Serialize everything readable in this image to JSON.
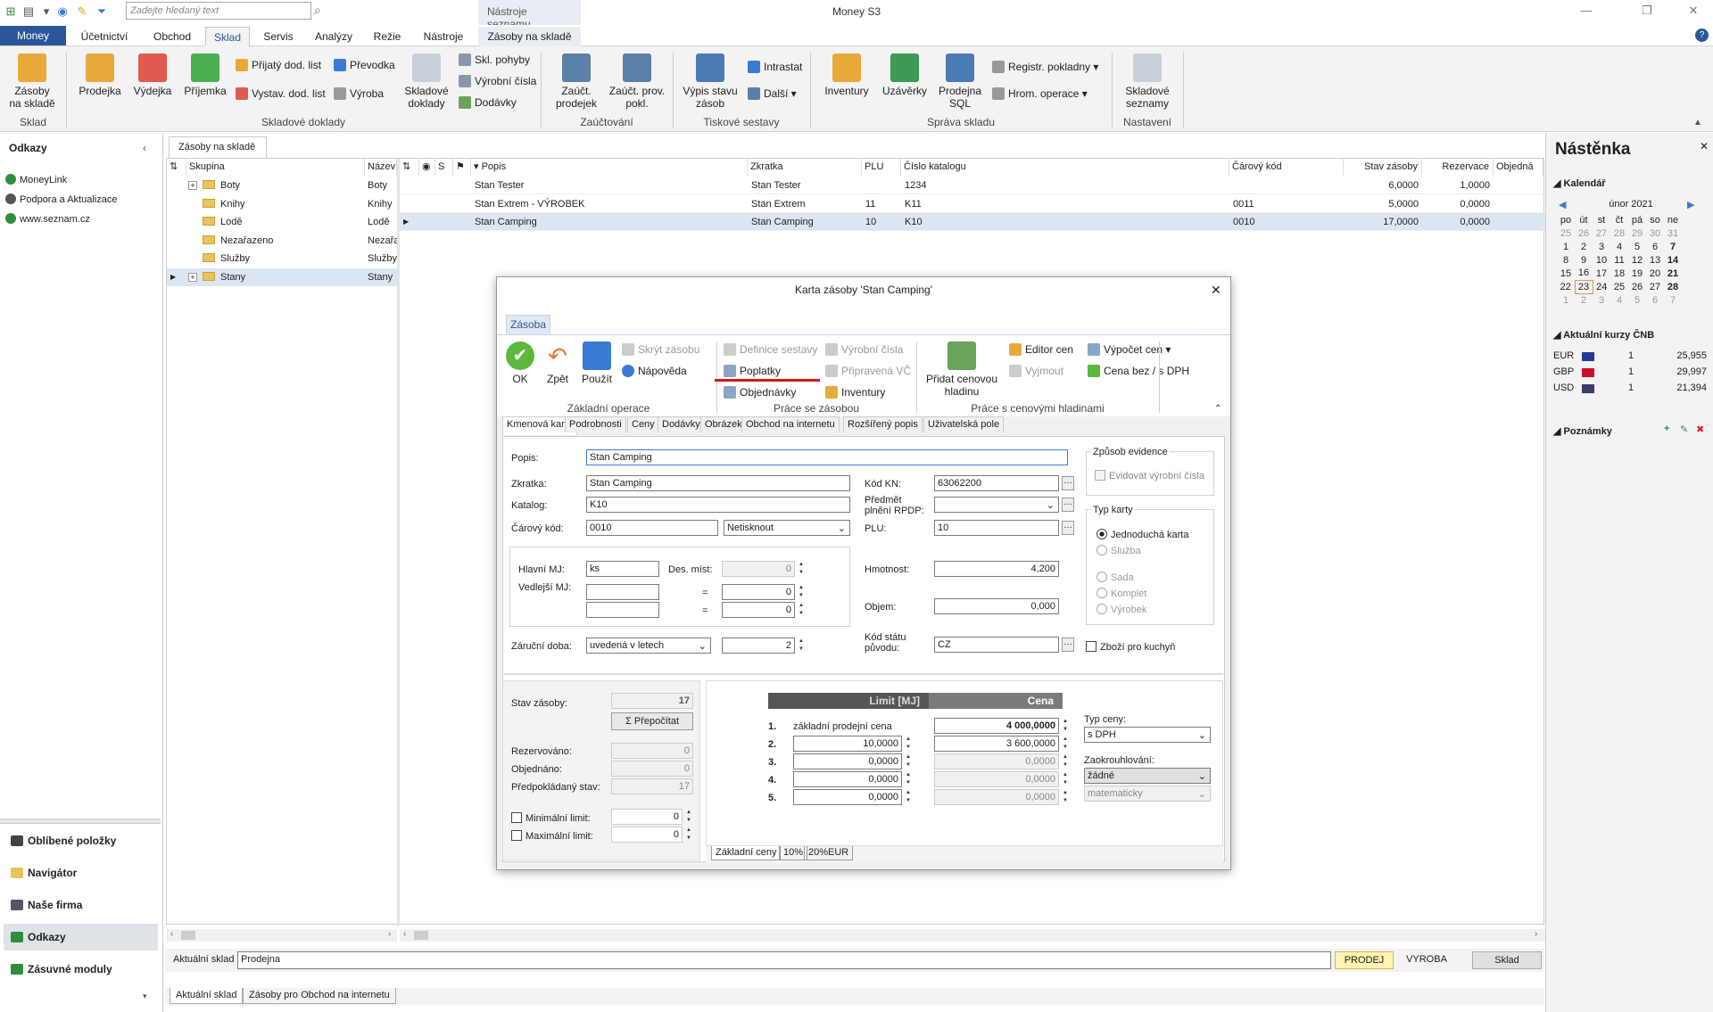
{
  "app": {
    "title": "Money S3",
    "search_placeholder": "Zadejte hledaný text",
    "context_label": "Nástroje seznamu"
  },
  "tabs": [
    "Money",
    "Účetnictví",
    "Obchod",
    "Sklad",
    "Servis",
    "Analýzy",
    "Režie",
    "Nástroje",
    "Zásoby na skladě"
  ],
  "ribbon": {
    "sklad_btn": "Zásoby na skladě",
    "sklad_group": "Sklad",
    "prodejka": "Prodejka",
    "vydejka": "Výdejka",
    "prijemka": "Příjemka",
    "prijaty": "Přijatý dod. list",
    "vystav": "Vystav. dod. list",
    "prevodka": "Převodka",
    "vyroba": "Výroba",
    "skladove_doklady": "Skladové doklady",
    "skl_pohyby": "Skl. pohyby",
    "vyrobni_cisla": "Výrobní čísla",
    "dodavky": "Dodávky",
    "doklady_group": "Skladové doklady",
    "zauct_prodejek": "Zaúčt. prodejek",
    "zauct_prov": "Zaúčt. prov. pokl.",
    "zauct_group": "Zaúčtování",
    "vypis_stavu": "Výpis stavu zásob",
    "intrastat": "Intrastat",
    "dalsi": "Další",
    "tisk_group": "Tiskové sestavy",
    "inventury": "Inventury",
    "uzaverky": "Uzávěrky",
    "prodejna_sql": "Prodejna SQL",
    "registr": "Registr. pokladny",
    "hrom": "Hrom. operace",
    "sprava_group": "Správa skladu",
    "skladove_seznamy": "Skladové seznamy",
    "nastaveni_group": "Nastavení"
  },
  "left": {
    "header": "Odkazy",
    "links": [
      "MoneyLink",
      "Podpora a Aktualizace",
      "www.seznam.cz"
    ],
    "nav": [
      "Oblíbené položky",
      "Navigátor",
      "Naše firma",
      "Odkazy",
      "Zásuvné moduly"
    ]
  },
  "main_tab": "Zásoby na skladě",
  "tree": {
    "headers": [
      "Skupina",
      "Název"
    ],
    "rows": [
      [
        "Boty",
        "Boty"
      ],
      [
        "Knihy",
        "Knihy"
      ],
      [
        "Lodě",
        "Lodě"
      ],
      [
        "Nezařazeno",
        "Nezařaz"
      ],
      [
        "Služby",
        "Služby"
      ],
      [
        "Stany",
        "Stany"
      ]
    ]
  },
  "table": {
    "headers": [
      "S",
      "Popis",
      "Zkratka",
      "PLU",
      "Číslo katalogu",
      "Čárový kód",
      "Stav zásoby",
      "Rezervace",
      "Objedná"
    ],
    "rows": [
      [
        "Stan Tester",
        "Stan Tester",
        "",
        "1234",
        "",
        "6,0000",
        "1,0000"
      ],
      [
        "Stan Extrem - VÝROBEK",
        "Stan Extrem",
        "11",
        "K11",
        "0011",
        "5,0000",
        "0,0000"
      ],
      [
        "Stan Camping",
        "Stan Camping",
        "10",
        "K10",
        "0010",
        "17,0000",
        "0,0000"
      ]
    ]
  },
  "status": {
    "label": "Aktuální sklad",
    "value": "Prodejna",
    "b1": "PRODEJ",
    "b2": "VYROBA",
    "b3": "Sklad",
    "tab1": "Aktuální sklad",
    "tab2": "Zásoby pro Obchod na internetu"
  },
  "dash": {
    "title": "Nástěnka",
    "cal": "Kalendář",
    "month": "únor 2021",
    "days": [
      "po",
      "út",
      "st",
      "čt",
      "pá",
      "so",
      "ne"
    ],
    "weeks": [
      [
        "25",
        "26",
        "27",
        "28",
        "29",
        "30",
        "31"
      ],
      [
        "1",
        "2",
        "3",
        "4",
        "5",
        "6",
        "7"
      ],
      [
        "8",
        "9",
        "10",
        "11",
        "12",
        "13",
        "14"
      ],
      [
        "15",
        "16",
        "17",
        "18",
        "19",
        "20",
        "21"
      ],
      [
        "22",
        "23",
        "24",
        "25",
        "26",
        "27",
        "28"
      ],
      [
        "1",
        "2",
        "3",
        "4",
        "5",
        "6",
        "7"
      ]
    ],
    "kurzy": "Aktuální kurzy ČNB",
    "rates": [
      [
        "EUR",
        "1",
        "25,955"
      ],
      [
        "GBP",
        "1",
        "29,997"
      ],
      [
        "USD",
        "1",
        "21,394"
      ]
    ],
    "notes": "Poznámky"
  },
  "dialog": {
    "title": "Karta zásoby 'Stan Camping'",
    "tab": "Zásoba",
    "tb": {
      "ok": "OK",
      "zpet": "Zpět",
      "pouzit": "Použít",
      "skryt": "Skrýt zásobu",
      "napoveda": "Nápověda",
      "g1": "Základní operace",
      "definice": "Definice sestavy",
      "poplatky": "Poplatky",
      "objednavky": "Objednávky",
      "vyrobni": "Výrobní čísla",
      "pripravena": "Připravená VČ",
      "inventury": "Inventury",
      "g2": "Práce se zásobou",
      "pridat": "Přidat cenovou hladinu",
      "editor": "Editor cen",
      "vyjmout": "Vyjmout",
      "vypocet": "Výpočet cen",
      "cenabez": "Cena bez / s DPH",
      "g3": "Práce s cenovými hladinami"
    },
    "tabs": [
      "Kmenová karta",
      "Podrobnosti",
      "Ceny",
      "Dodávky",
      "Obrázek",
      "Obchod na internetu",
      "Rozšířený popis",
      "Uživatelská pole"
    ],
    "f": {
      "popis_l": "Popis:",
      "popis": "Stan Camping",
      "zkratka_l": "Zkratka:",
      "zkratka": "Stan Camping",
      "katalog_l": "Katalog:",
      "katalog": "K10",
      "carovy_l": "Čárový kód:",
      "carovy": "0010",
      "netisk": "Netisknout",
      "kodkn_l": "Kód KN:",
      "kodkn": "63062200",
      "predmet_l": "Předmět plnění RPDP:",
      "plu_l": "PLU:",
      "plu": "10",
      "hlavni_l": "Hlavní MJ:",
      "hlavni": "ks",
      "desmist_l": "Des. míst:",
      "desmist": "0",
      "vedlejsi_l": "Vedlejší MJ:",
      "eq": "=",
      "v1": "0",
      "v2": "0",
      "hmotnost_l": "Hmotnost:",
      "hmotnost": "4,200",
      "objem_l": "Objem:",
      "objem": "0,000",
      "zaruka_l": "Záruční doba:",
      "zaruka": "uvedená v letech",
      "zaruka_n": "2",
      "kodstatu_l": "Kód státu původu:",
      "kodstatu": "CZ",
      "zpusob": "Způsob evidence",
      "evidovat": "Evidovat výrobní čísla",
      "typkarty": "Typ karty",
      "typy": [
        "Jednoduchá karta",
        "Služba",
        "Sada",
        "Komplet",
        "Výrobek"
      ],
      "kuchyn": "Zboží pro kuchyň"
    },
    "stav": {
      "stav_l": "Stav zásoby:",
      "stav": "17",
      "prepocitat": "Σ Přepočítat",
      "rez_l": "Rezervováno:",
      "rez": "0",
      "obj_l": "Objednáno:",
      "obj": "0",
      "pred_l": "Předpokládaný stav:",
      "pred": "17",
      "min_l": "Minimální limit:",
      "min": "0",
      "max_l": "Maximální limit:",
      "max": "0"
    },
    "ceny": {
      "h1": "Limit [MJ]",
      "h2": "Cena",
      "rows": [
        [
          "1.",
          "základní prodejní cena",
          "4 000,0000"
        ],
        [
          "2.",
          "10,0000",
          "3 600,0000"
        ],
        [
          "3.",
          "0,0000",
          "0,0000"
        ],
        [
          "4.",
          "0,0000",
          "0,0000"
        ],
        [
          "5.",
          "0,0000",
          "0,0000"
        ]
      ],
      "typ_l": "Typ ceny:",
      "typ": "s DPH",
      "zaok_l": "Zaokrouhlování:",
      "zaok": "žádné",
      "zaok2": "matematicky",
      "tabs": [
        "Základní ceny",
        "10%",
        "20%EUR"
      ]
    }
  }
}
